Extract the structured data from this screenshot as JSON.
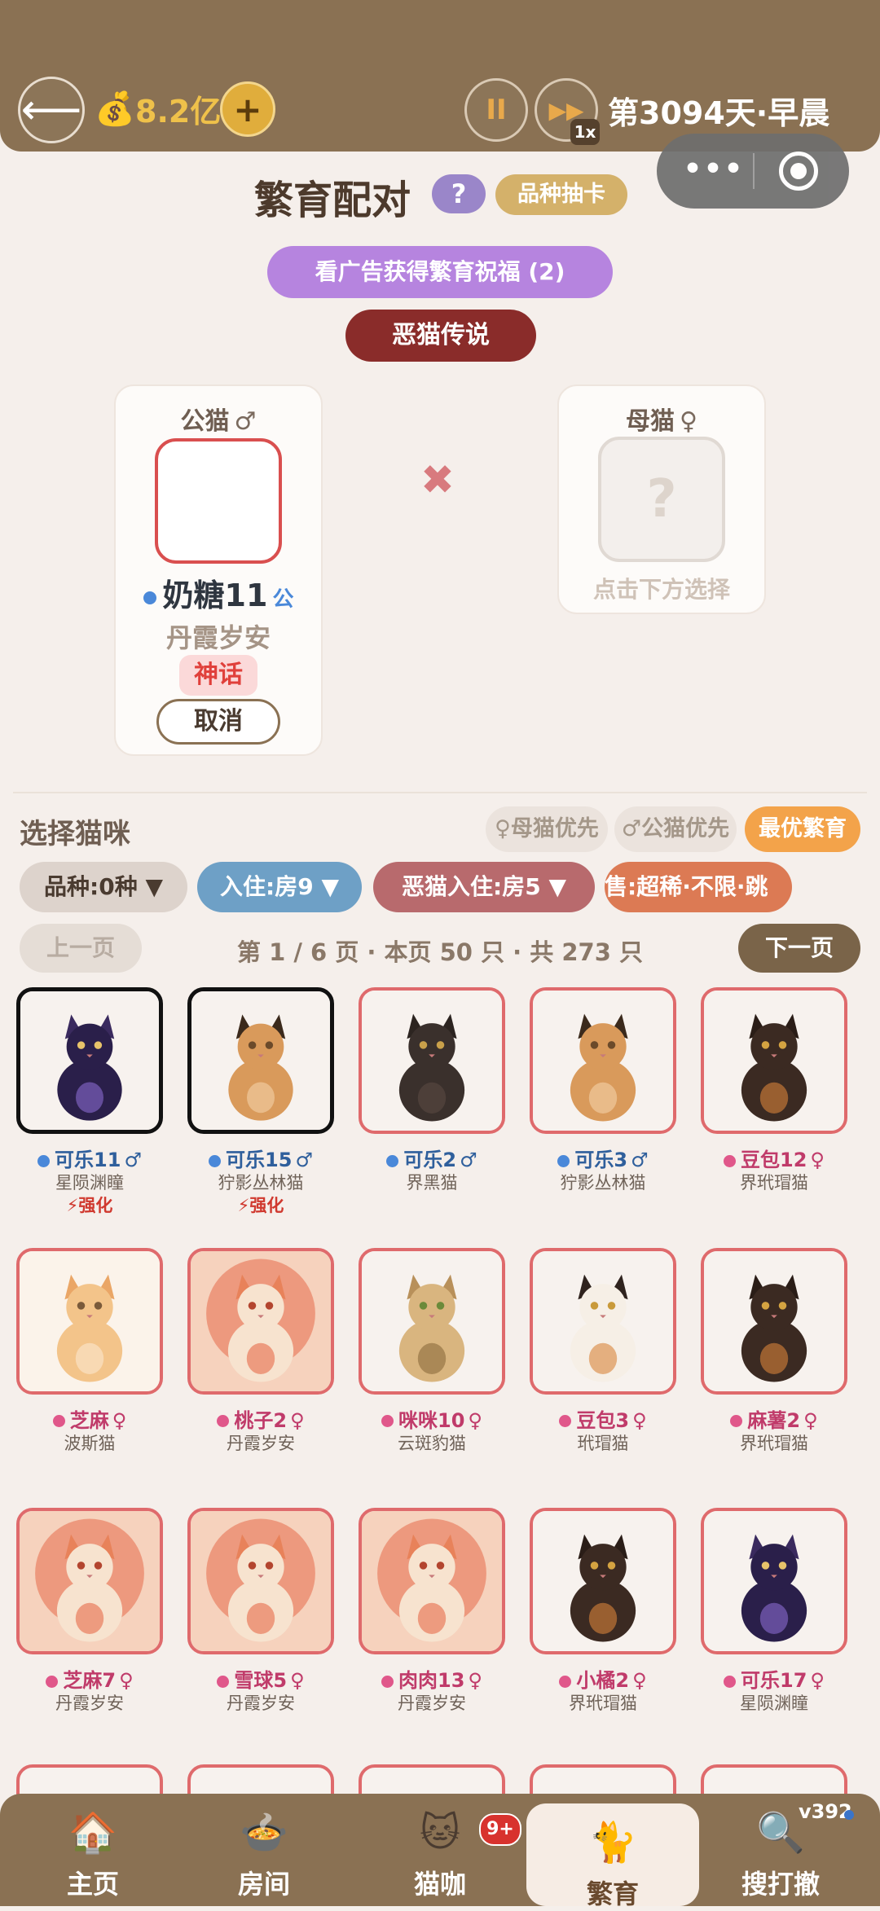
{
  "header": {
    "money": "8.2亿",
    "add_label": "+",
    "pause_label": "II",
    "speed_label": "1x",
    "day_text": "第3094天·早晨"
  },
  "page": {
    "title": "繁育配对",
    "help_label": "?",
    "breed_card_label": "品种抽卡",
    "ad_button": "看广告获得繁育祝福 (2)",
    "legend_button": "恶猫传说"
  },
  "pairing": {
    "male_label": "公猫",
    "male_symbol": "♂",
    "male_name": "奶糖11",
    "male_tag": "公",
    "male_breed": "丹霞岁安",
    "male_rarity": "神话",
    "cancel_label": "取消",
    "cross_symbol": "✖",
    "female_label": "母猫",
    "female_symbol": "♀",
    "female_placeholder": "?",
    "female_hint": "点击下方选择"
  },
  "selection": {
    "title": "选择猫咪",
    "female_priority": "♀母猫优先",
    "male_priority": "♂公猫优先",
    "best_breed": "最优繁育",
    "filter_breed": "品种:0种 ▼",
    "filter_room": "入住:房9 ▼",
    "filter_evil": "恶猫入住:房5 ▼",
    "filter_sale": "售:超稀·不限·跳",
    "prev_page": "上一页",
    "page_info": "第 1 / 6 页 · 本页 50 只 · 共 273 只",
    "next_page": "下一页"
  },
  "cats": [
    {
      "name": "可乐11",
      "sex": "male",
      "symbol": "♂",
      "breed": "星陨渊瞳",
      "boost": "⚡强化",
      "selected": true,
      "look": "cosmic"
    },
    {
      "name": "可乐15",
      "sex": "male",
      "symbol": "♂",
      "breed": "狞影丛林猫",
      "boost": "⚡强化",
      "selected": true,
      "look": "caracal"
    },
    {
      "name": "可乐2",
      "sex": "male",
      "symbol": "♂",
      "breed": "界黑猫",
      "boost": "",
      "selected": false,
      "look": "black"
    },
    {
      "name": "可乐3",
      "sex": "male",
      "symbol": "♂",
      "breed": "狞影丛林猫",
      "boost": "",
      "selected": false,
      "look": "caracal"
    },
    {
      "name": "豆包12",
      "sex": "female",
      "symbol": "♀",
      "breed": "界玳瑁猫",
      "boost": "",
      "selected": false,
      "look": "tortie"
    },
    {
      "name": "芝麻",
      "sex": "female",
      "symbol": "♀",
      "breed": "波斯猫",
      "boost": "",
      "selected": false,
      "look": "persian"
    },
    {
      "name": "桃子2",
      "sex": "female",
      "symbol": "♀",
      "breed": "丹霞岁安",
      "boost": "",
      "selected": false,
      "look": "danxia"
    },
    {
      "name": "咪咪10",
      "sex": "female",
      "symbol": "♀",
      "breed": "云斑豹猫",
      "boost": "",
      "selected": false,
      "look": "bengal"
    },
    {
      "name": "豆包3",
      "sex": "female",
      "symbol": "♀",
      "breed": "玳瑁猫",
      "boost": "",
      "selected": false,
      "look": "calico"
    },
    {
      "name": "麻薯2",
      "sex": "female",
      "symbol": "♀",
      "breed": "界玳瑁猫",
      "boost": "",
      "selected": false,
      "look": "tortie"
    },
    {
      "name": "芝麻7",
      "sex": "female",
      "symbol": "♀",
      "breed": "丹霞岁安",
      "boost": "",
      "selected": false,
      "look": "danxia"
    },
    {
      "name": "雪球5",
      "sex": "female",
      "symbol": "♀",
      "breed": "丹霞岁安",
      "boost": "",
      "selected": false,
      "look": "danxia"
    },
    {
      "name": "肉肉13",
      "sex": "female",
      "symbol": "♀",
      "breed": "丹霞岁安",
      "boost": "",
      "selected": false,
      "look": "danxia"
    },
    {
      "name": "小橘2",
      "sex": "female",
      "symbol": "♀",
      "breed": "界玳瑁猫",
      "boost": "",
      "selected": false,
      "look": "tortie"
    },
    {
      "name": "可乐17",
      "sex": "female",
      "symbol": "♀",
      "breed": "星陨渊瞳",
      "boost": "",
      "selected": false,
      "look": "cosmic"
    }
  ],
  "nav": [
    {
      "label": "主页",
      "icon": "🏠",
      "icon_name": "home-icon",
      "active": false
    },
    {
      "label": "房间",
      "icon": "🍲",
      "icon_name": "room-icon",
      "active": false
    },
    {
      "label": "猫咖",
      "icon": "🐱",
      "icon_name": "cat-cafe-icon",
      "active": false
    },
    {
      "label": "繁育",
      "icon": "🐈",
      "icon_name": "breeding-icon",
      "active": true
    },
    {
      "label": "搜打撤",
      "icon": "🔍",
      "icon_name": "search-retreat-icon",
      "active": false
    }
  ],
  "nav_badge": "9+",
  "version": "v392",
  "colors": {
    "brown": "#8a7153",
    "male_blue": "#4a88d9",
    "female_pink": "#e0578a",
    "card_border": "#df6a6c"
  }
}
